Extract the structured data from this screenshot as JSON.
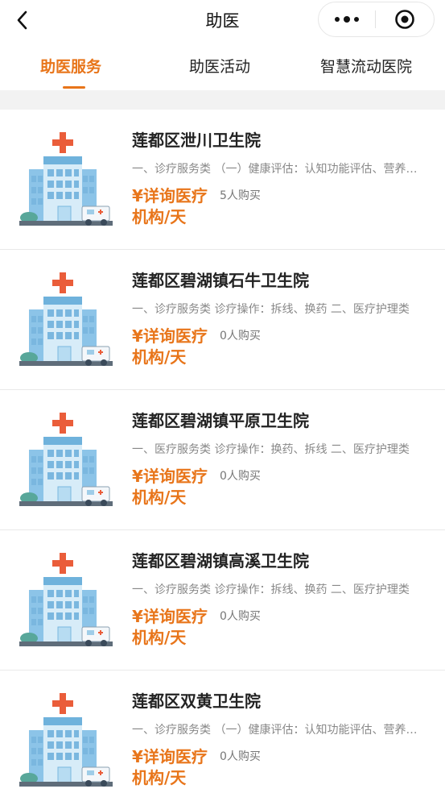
{
  "nav": {
    "title": "助医",
    "back_icon": "chevron-left-icon",
    "more_icon": "more-dots-icon",
    "close_icon": "target-close-icon"
  },
  "tabs": [
    {
      "label": "助医服务",
      "active": true
    },
    {
      "label": "助医活动",
      "active": false
    },
    {
      "label": "智慧流动医院",
      "active": false
    }
  ],
  "colors": {
    "accent": "#e8751a",
    "building": "#74b6e0",
    "cross": "#ea5d3a"
  },
  "items": [
    {
      "title": "莲都区泄川卫生院",
      "desc": "一、诊疗服务类 （一）健康评估：认知功能评估、营养评估",
      "price": "¥详询医疗机构/天",
      "sold": "5人购买"
    },
    {
      "title": "莲都区碧湖镇石牛卫生院",
      "desc": "一、诊疗服务类 诊疗操作：拆线、换药 二、医疗护理类",
      "price": "¥详询医疗机构/天",
      "sold": "0人购买"
    },
    {
      "title": "莲都区碧湖镇平原卫生院",
      "desc": "一、医疗服务类 诊疗操作：换药、拆线 二、医疗护理类",
      "price": "¥详询医疗机构/天",
      "sold": "0人购买"
    },
    {
      "title": "莲都区碧湖镇高溪卫生院",
      "desc": "一、诊疗服务类 诊疗操作：拆线、换药 二、医疗护理类",
      "price": "¥详询医疗机构/天",
      "sold": "0人购买"
    },
    {
      "title": "莲都区双黄卫生院",
      "desc": "一、诊疗服务类 （一）健康评估：认知功能评估、营养评估",
      "price": "¥详询医疗机构/天",
      "sold": "0人购买"
    }
  ]
}
